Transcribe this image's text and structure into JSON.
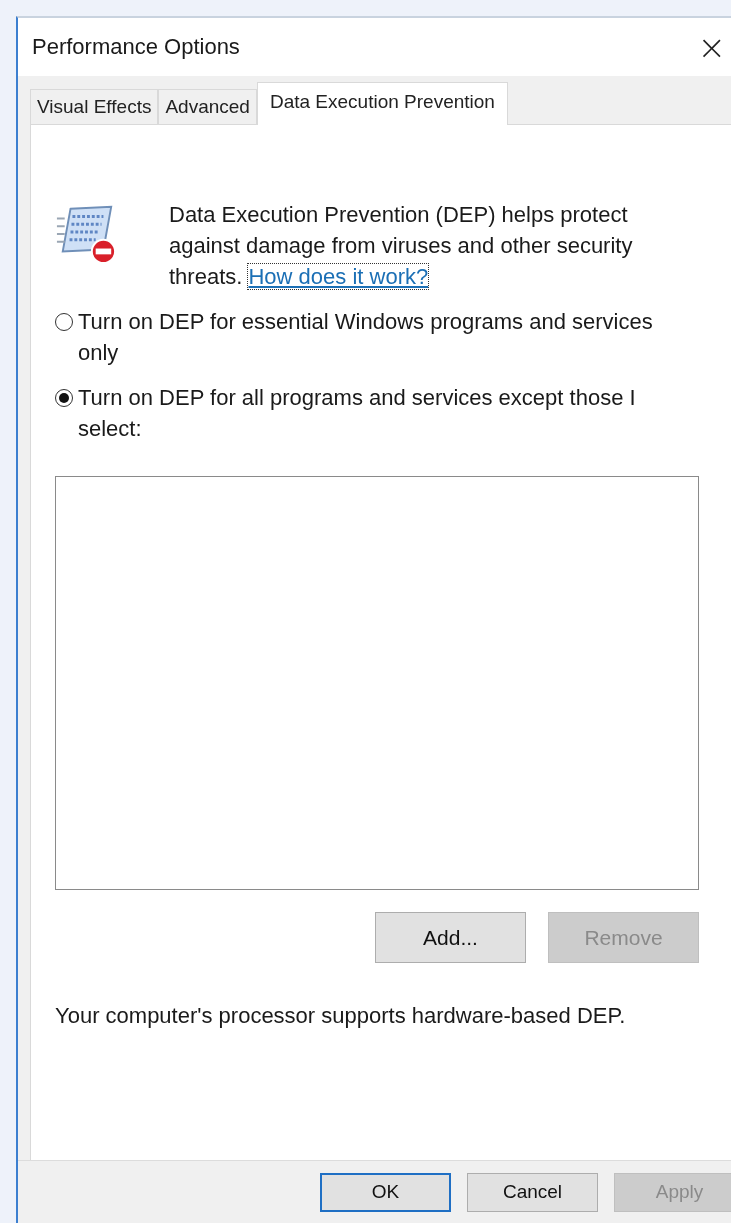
{
  "window": {
    "title": "Performance Options",
    "close": "×"
  },
  "tabs": [
    {
      "label": "Visual Effects",
      "selected": false
    },
    {
      "label": "Advanced",
      "selected": false
    },
    {
      "label": "Data Execution Prevention",
      "selected": true
    }
  ],
  "intro": {
    "text": "Data Execution Prevention (DEP) helps protect against damage from viruses and other security threats.",
    "link": "How does it work?"
  },
  "options": [
    {
      "label": "Turn on DEP for essential Windows programs and services only",
      "selected": false
    },
    {
      "label": "Turn on DEP for all programs and services except those I select:",
      "selected": true
    }
  ],
  "list_buttons": [
    {
      "label": "Add...",
      "disabled": false
    },
    {
      "label": "Remove",
      "disabled": true
    }
  ],
  "status": "Your computer's processor supports hardware-based DEP.",
  "buttons": [
    {
      "label": "OK",
      "disabled": false,
      "default": true
    },
    {
      "label": "Cancel",
      "disabled": false,
      "default": false
    },
    {
      "label": "Apply",
      "disabled": true,
      "default": false
    }
  ]
}
